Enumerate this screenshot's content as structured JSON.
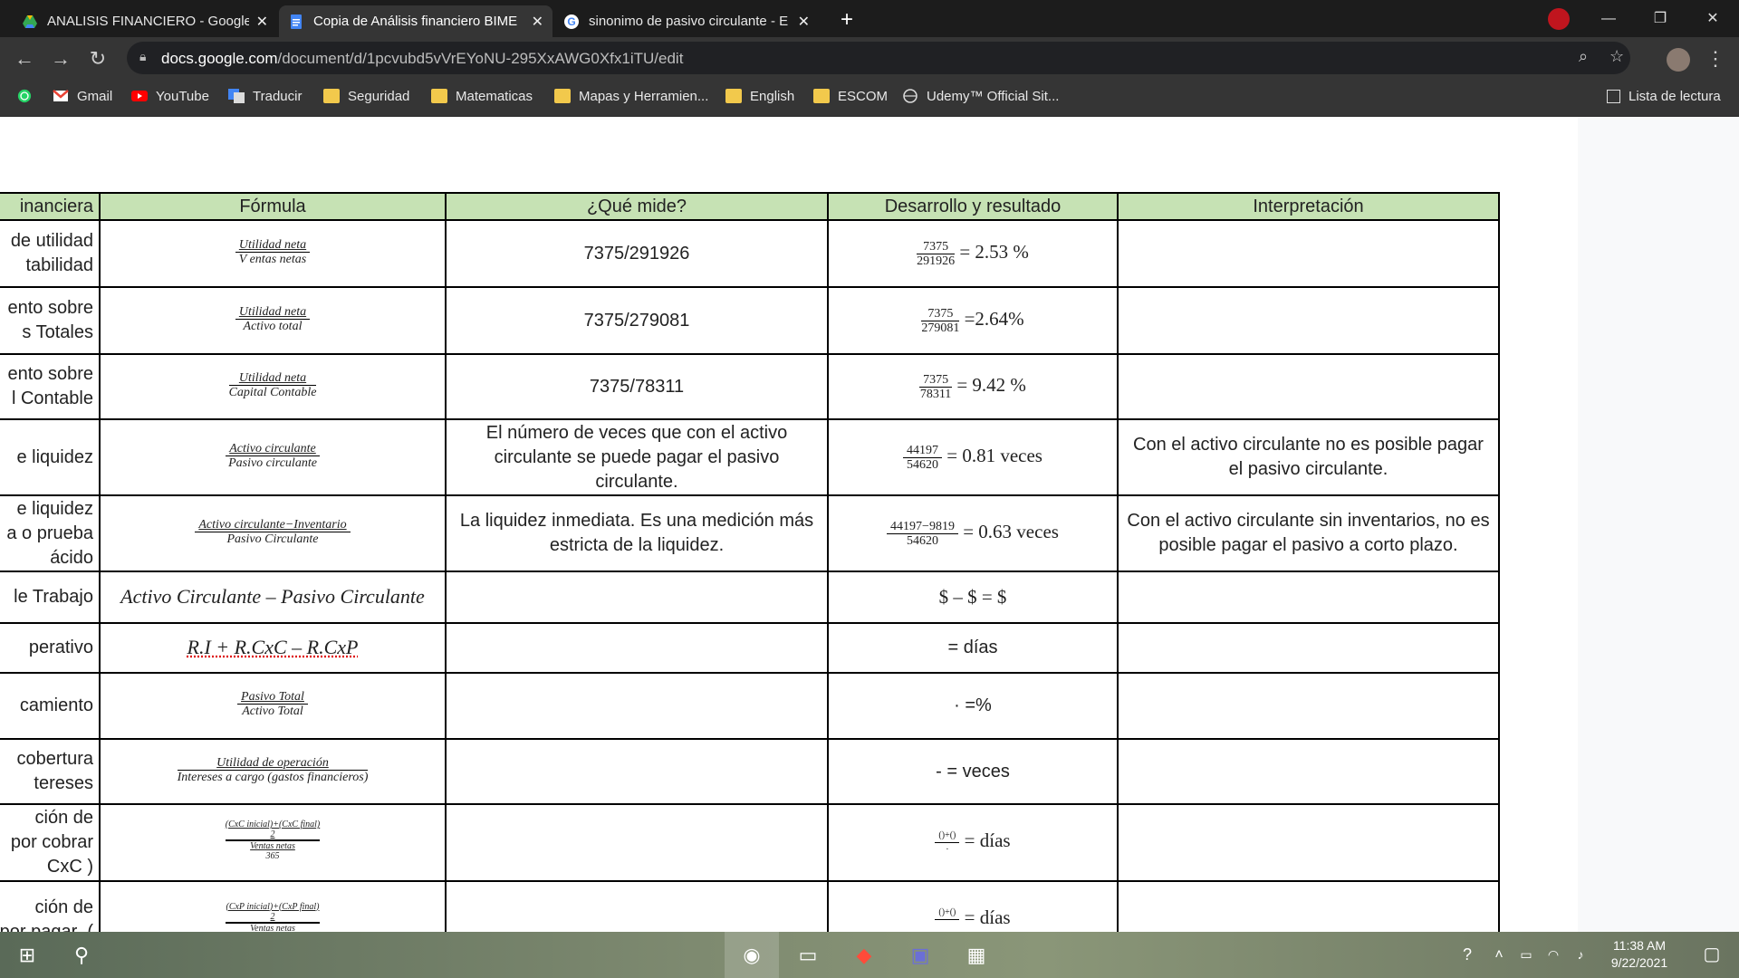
{
  "browser": {
    "tabs": [
      {
        "title": "ANALISIS FINANCIERO - Google",
        "icon": "google-drive-icon",
        "active": false
      },
      {
        "title": "Copia de Análisis financiero BIME",
        "icon": "google-docs-icon",
        "active": true
      },
      {
        "title": "sinonimo de pasivo circulante - E",
        "icon": "google-icon",
        "active": false
      }
    ],
    "new_tab": "+",
    "url_host": "docs.google.com",
    "url_path": "/document/d/1pcvubd5vVrEYoNU-295XxAWG0Xfx1iTU/edit",
    "bookmarks": [
      {
        "label": "",
        "icon": "whatsapp-icon"
      },
      {
        "label": "Gmail",
        "icon": "gmail-icon"
      },
      {
        "label": "YouTube",
        "icon": "youtube-icon"
      },
      {
        "label": "Traducir",
        "icon": "translate-icon"
      },
      {
        "label": "Seguridad",
        "icon": "folder-icon"
      },
      {
        "label": "Matematicas",
        "icon": "folder-icon"
      },
      {
        "label": "Mapas y Herramien...",
        "icon": "folder-icon"
      },
      {
        "label": "English",
        "icon": "folder-icon"
      },
      {
        "label": "ESCOM",
        "icon": "folder-icon"
      },
      {
        "label": "Udemy™ Official Sit...",
        "icon": "udemy-icon"
      }
    ],
    "reading_list": "Lista de lectura"
  },
  "table": {
    "headers": [
      "inanciera",
      "Fórmula",
      "¿Qué mide?",
      "Desarrollo y resultado",
      "Interpretación"
    ],
    "rows": [
      {
        "name": "de utilidad\ntabilidad",
        "formula_num": "Utilidad neta",
        "formula_den": "V entas netas",
        "mide": "7375/291926",
        "res_num": "7375",
        "res_den": "291926",
        "res_text": "= 2.53 %",
        "interp": ""
      },
      {
        "name": "ento sobre\ns Totales",
        "formula_num": "Utilidad neta",
        "formula_den": "Activo total",
        "mide": "7375/279081",
        "res_num": "7375",
        "res_den": "279081",
        "res_text": "=2.64%",
        "interp": ""
      },
      {
        "name": "ento sobre\nl Contable",
        "formula_num": "Utilidad neta",
        "formula_den": "Capital Contable",
        "mide": "7375/78311",
        "res_num": "7375",
        "res_den": "78311",
        "res_text": "= 9.42 %",
        "interp": ""
      },
      {
        "name": "e liquidez",
        "formula_num": "Activo circulante",
        "formula_den": "Pasivo circulante",
        "mide": "El número de veces que con el activo circulante se puede pagar el pasivo circulante.",
        "res_num": "44197",
        "res_den": "54620",
        "res_text": "= 0.81 veces",
        "interp": "Con el activo circulante no es posible pagar el pasivo circulante."
      },
      {
        "name": "e liquidez\na o prueba\nácido",
        "formula_num": "Activo circulante−Inventario",
        "formula_den": "Pasivo Circulante",
        "mide": "La liquidez inmediata. Es una medición más estricta de la liquidez.",
        "res_num": "44197−9819",
        "res_den": "54620",
        "res_text": "= 0.63 veces",
        "interp": "Con el activo circulante sin inventarios, no es posible pagar el pasivo a corto plazo."
      },
      {
        "name": "le Trabajo",
        "formula_text": "Activo Circulante – Pasivo Circulante",
        "mide": "",
        "res_text": "$ – $ = $",
        "interp": ""
      },
      {
        "name": "perativo",
        "formula_text": "R.I  + R.CxC – R.CxP",
        "mide": "",
        "res_text": "= días",
        "interp": ""
      },
      {
        "name": "camiento",
        "formula_num": "Pasivo Total",
        "formula_den": "Activo Total",
        "mide": "",
        "res_text": "· =%",
        "interp": ""
      },
      {
        "name": " cobertura\ntereses",
        "formula_num": "Utilidad de operación",
        "formula_den": "Intereses a cargo (gastos financieros)",
        "mide": "",
        "res_text": "- = veces",
        "interp": ""
      },
      {
        "name": "ción de\npor cobrar\nCxC )",
        "formula_num": "(CxC inicial)+(CxC final)",
        "formula_mid": "2",
        "formula_den": "Ventas netas",
        "formula_den2": "365",
        "mide": "",
        "res_num": "()+()",
        "res_text": "= días",
        "interp": ""
      },
      {
        "name": "ción de\npor pagar  (",
        "formula_num": "(CxP inicial)+(CxP final)",
        "formula_mid": "2",
        "formula_den": "Ventas netas",
        "mide": "",
        "res_num": "()+()",
        "res_text": "= días",
        "interp": ""
      }
    ]
  },
  "taskbar": {
    "time": "11:38 AM",
    "date": "9/22/2021"
  }
}
